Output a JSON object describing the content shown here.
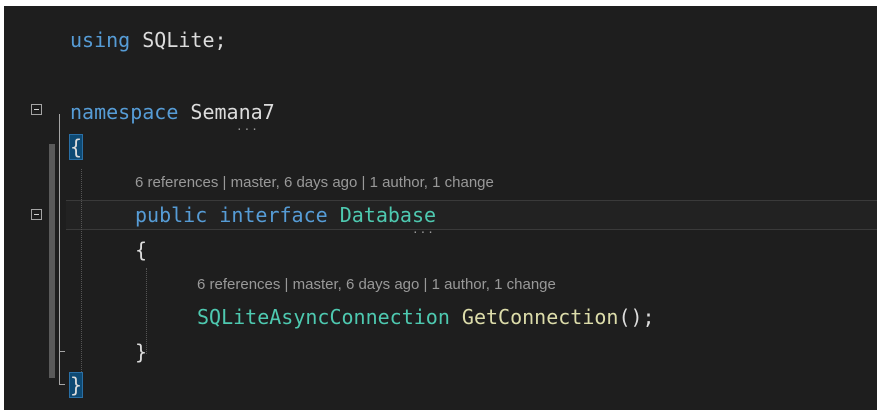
{
  "editor": {
    "lines": {
      "using_kw": "using",
      "using_ns": "SQLite",
      "using_semicolon": ";",
      "namespace_kw": "namespace",
      "namespace_name": "Semana7",
      "open_brace": "{",
      "lens_interface": "6 references | master, 6 days ago | 1 author, 1 change",
      "public_kw": "public",
      "interface_kw": "interface",
      "interface_name": "Database",
      "inner_open_brace": "{",
      "lens_method": "6 references | master, 6 days ago | 1 author, 1 change",
      "return_type": "SQLiteAsyncConnection",
      "method_name": "GetConnection",
      "method_tail": "();",
      "inner_close_brace": "}",
      "close_brace": "}"
    }
  },
  "colors": {
    "background": "#1e1e1e",
    "keyword": "#569cd6",
    "type": "#4ec9b0",
    "method": "#dcdcaa",
    "text": "#dcdcdc",
    "codelens": "#999999",
    "brace_highlight": "#0e4a74"
  },
  "icons": {
    "collapse_namespace": "collapse-icon",
    "collapse_interface": "collapse-icon"
  }
}
